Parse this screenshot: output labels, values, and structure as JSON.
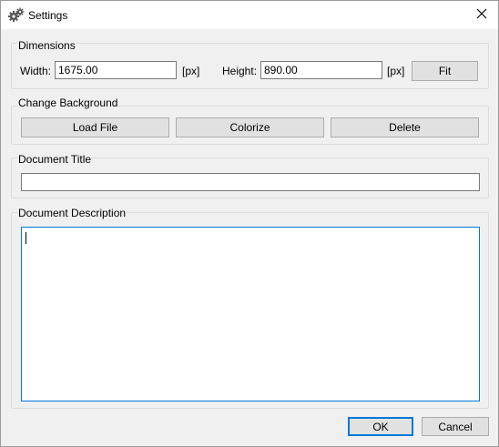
{
  "window": {
    "title": "Settings",
    "icon": "gears-icon",
    "close": "close-icon"
  },
  "dimensions": {
    "label": "Dimensions",
    "width_label": "Width:",
    "width_value": "1675.00",
    "unit1": "[px]",
    "height_label": "Height:",
    "height_value": "890.00",
    "unit2": "[px]",
    "fit_label": "Fit"
  },
  "background": {
    "label": "Change Background",
    "load_label": "Load File",
    "colorize_label": "Colorize",
    "delete_label": "Delete"
  },
  "doc_title": {
    "label": "Document Title",
    "value": ""
  },
  "doc_description": {
    "label": "Document Description",
    "value": ""
  },
  "footer": {
    "ok_label": "OK",
    "cancel_label": "Cancel"
  },
  "colors": {
    "accent": "#0078d7",
    "button_face": "#e1e1e1",
    "dialog_bg": "#f0f0f0"
  }
}
